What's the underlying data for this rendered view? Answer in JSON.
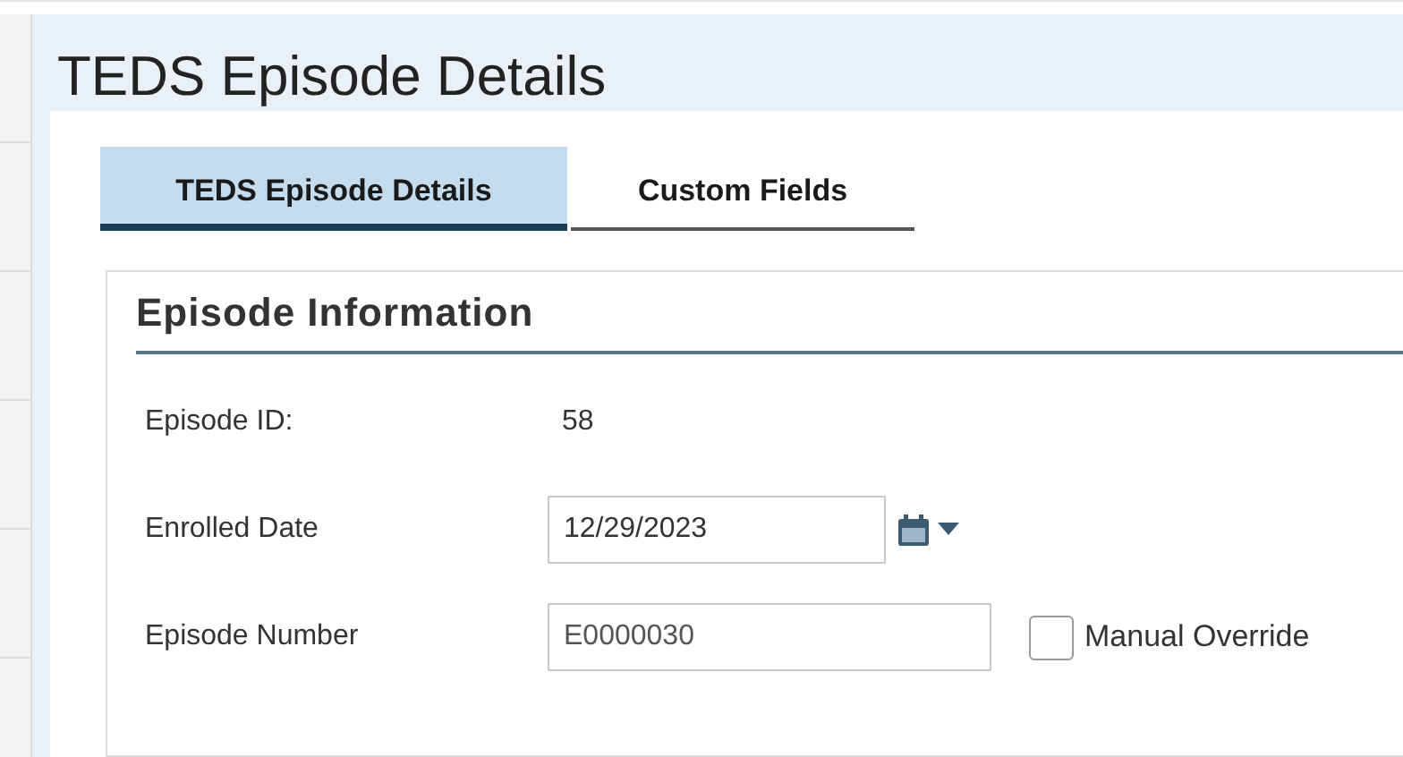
{
  "page": {
    "title": "TEDS Episode Details"
  },
  "tabs": [
    {
      "label": "TEDS Episode Details",
      "selected": true
    },
    {
      "label": "Custom Fields",
      "selected": false
    }
  ],
  "section": {
    "title": "Episode Information",
    "fields": [
      {
        "kind": "text",
        "label": "Episode ID:",
        "value": "58"
      },
      {
        "kind": "date",
        "label": "Enrolled Date",
        "value": "12/29/2023"
      },
      {
        "kind": "input",
        "label": "Episode Number",
        "value": "E0000030",
        "checkbox": {
          "label": "Manual Override",
          "checked": false
        }
      }
    ]
  }
}
